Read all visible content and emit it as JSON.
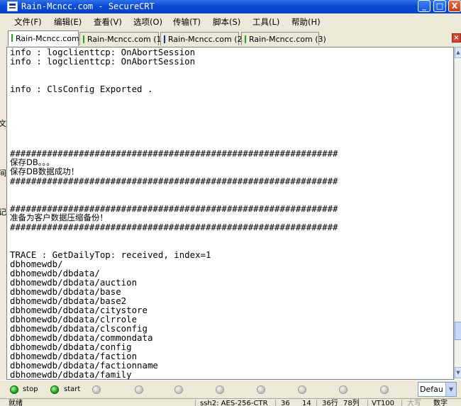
{
  "window": {
    "title": "Rain-Mcncc.com - SecureCRT",
    "controls": [
      "_",
      "□",
      "X"
    ]
  },
  "menu": [
    "文件(F)",
    "编辑(E)",
    "查看(V)",
    "选项(O)",
    "传输(T)",
    "脚本(S)",
    "工具(L)",
    "帮助(H)"
  ],
  "tabs": [
    {
      "label": "Rain-Mcncc.com",
      "active": true,
      "color": "#22a21d"
    },
    {
      "label": "Rain-Mcncc.com (1)",
      "active": false,
      "color": "#22a21d"
    },
    {
      "label": "Rain-Mcncc.com (2)",
      "active": false,
      "color": "#1a2aa8"
    },
    {
      "label": "Rain-Mcncc.com (3)",
      "active": false,
      "color": "#22a21d"
    }
  ],
  "terminal": {
    "lines": [
      "info : logclienttcp: OnAbortSession",
      "info : logclienttcp: OnAbortSession",
      "",
      "",
      "info : ClsConfig Exported .",
      "",
      "",
      "",
      "",
      "",
      "",
      "##############################################################",
      "保存DB。。。",
      "保存DB数据成功！",
      "##############################################################",
      "",
      "",
      "##############################################################",
      "准备为客户数据压缩备份！",
      "##############################################################",
      "",
      "",
      "TRACE : GetDailyTop: received, index=1",
      "dbhomewdb/",
      "dbhomewdb/dbdata/",
      "dbhomewdb/dbdata/auction",
      "dbhomewdb/dbdata/base",
      "dbhomewdb/dbdata/base2",
      "dbhomewdb/dbdata/citystore",
      "dbhomewdb/dbdata/clrrole",
      "dbhomewdb/dbdata/clsconfig",
      "dbhomewdb/dbdata/commondata",
      "dbhomewdb/dbdata/config",
      "dbhomewdb/dbdata/faction",
      "dbhomewdb/dbdata/factionname",
      "dbhomewdb/dbdata/family"
    ]
  },
  "buttonbar": {
    "buttons": [
      {
        "label": "stop",
        "state": "green"
      },
      {
        "label": "start",
        "state": "green"
      }
    ],
    "session_select": "Defau"
  },
  "statusbar": {
    "ready": "就绪",
    "cipher": "ssh2: AES-256-CTR",
    "row": "36",
    "col": "14",
    "rows": "36行",
    "cols": "78列",
    "term": "VT100",
    "caps": "大写",
    "num": "数字"
  }
}
